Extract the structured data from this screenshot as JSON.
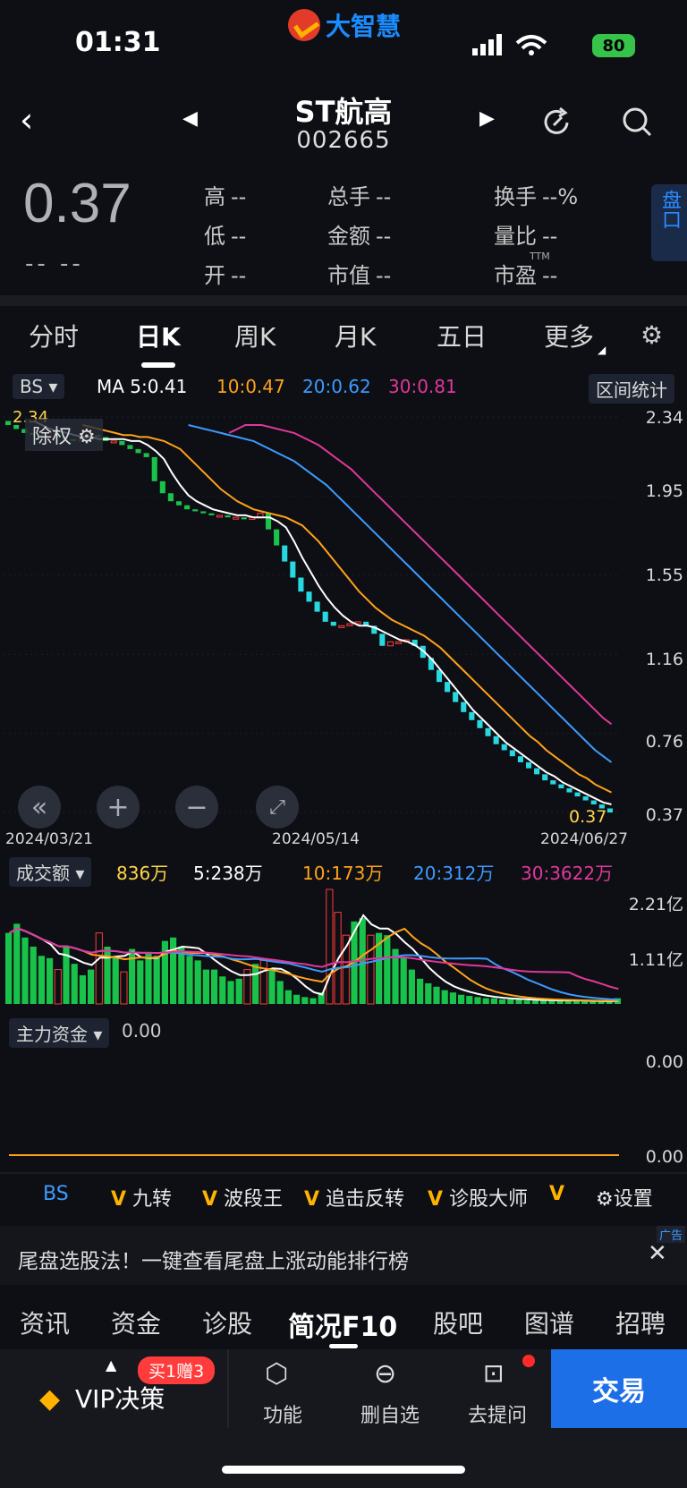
{
  "status": {
    "time": "01:31",
    "app_logo": "大智慧",
    "battery": "80"
  },
  "header": {
    "title": "ST航高",
    "code": "002665"
  },
  "quote": {
    "price": "0.37",
    "change": "--  --",
    "high_label": "高",
    "high": "--",
    "low_label": "低",
    "low": "--",
    "open_label": "开",
    "open": "--",
    "vol_label": "总手",
    "vol": "--",
    "amt_label": "金额",
    "amt": "--",
    "mcap_label": "市值",
    "mcap": "--",
    "turn_label": "换手",
    "turn": "--%",
    "ratio_label": "量比",
    "ratio": "--",
    "pe_label": "市盈",
    "pe": "--",
    "pe_sup": "TTM",
    "pankou": "盘口"
  },
  "tabs": [
    "分时",
    "日K",
    "周K",
    "月K",
    "五日",
    "更多"
  ],
  "ma_bar": {
    "bs": "BS",
    "ma5": "MA 5:0.41",
    "ma10": "10:0.47",
    "ma20": "20:0.62",
    "ma30": "30:0.81",
    "range_btn": "区间统计"
  },
  "chart_data": {
    "type": "candlestick",
    "price_axis": [
      "2.34",
      "1.95",
      "1.55",
      "1.16",
      "0.76",
      "0.37"
    ],
    "dates": [
      "2024/03/21",
      "2024/05/14",
      "2024/06/27"
    ],
    "ylim": [
      0.37,
      2.34
    ],
    "last_price_label": "0.37",
    "top_label": "2.34",
    "close": [
      2.3,
      2.28,
      2.26,
      2.25,
      2.24,
      2.26,
      2.24,
      2.23,
      2.22,
      2.24,
      2.25,
      2.24,
      2.22,
      2.22,
      2.2,
      2.18,
      2.16,
      2.14,
      2.02,
      1.96,
      1.92,
      1.9,
      1.88,
      1.87,
      1.86,
      1.85,
      1.85,
      1.84,
      1.84,
      1.83,
      1.84,
      1.86,
      1.78,
      1.7,
      1.62,
      1.54,
      1.47,
      1.42,
      1.37,
      1.32,
      1.3,
      1.3,
      1.31,
      1.32,
      1.3,
      1.26,
      1.2,
      1.22,
      1.22,
      1.23,
      1.2,
      1.14,
      1.08,
      1.02,
      0.97,
      0.92,
      0.87,
      0.83,
      0.79,
      0.75,
      0.71,
      0.68,
      0.65,
      0.62,
      0.59,
      0.56,
      0.53,
      0.51,
      0.49,
      0.47,
      0.45,
      0.43,
      0.41,
      0.39,
      0.37
    ],
    "ma5": [
      2.32,
      2.3,
      2.28,
      2.27,
      2.26,
      2.25,
      2.24,
      2.24,
      2.23,
      2.23,
      2.23,
      2.23,
      2.22,
      2.22,
      2.2,
      2.17,
      2.13,
      2.06,
      2.0,
      1.95,
      1.92,
      1.9,
      1.88,
      1.87,
      1.86,
      1.85,
      1.85,
      1.84,
      1.84,
      1.84,
      1.82,
      1.79,
      1.72,
      1.64,
      1.57,
      1.5,
      1.44,
      1.39,
      1.35,
      1.32,
      1.3,
      1.3,
      1.29,
      1.27,
      1.25,
      1.23,
      1.22,
      1.2,
      1.17,
      1.13,
      1.08,
      1.03,
      0.98,
      0.93,
      0.88,
      0.84,
      0.8,
      0.76,
      0.72,
      0.69,
      0.66,
      0.63,
      0.6,
      0.57,
      0.55,
      0.52,
      0.5,
      0.48,
      0.46,
      0.44,
      0.42,
      0.41
    ],
    "ma10": [
      2.3,
      2.29,
      2.28,
      2.27,
      2.26,
      2.25,
      2.25,
      2.24,
      2.24,
      2.23,
      2.22,
      2.2,
      2.18,
      2.14,
      2.1,
      2.06,
      2.02,
      1.98,
      1.95,
      1.92,
      1.9,
      1.88,
      1.87,
      1.86,
      1.85,
      1.84,
      1.82,
      1.8,
      1.76,
      1.72,
      1.67,
      1.62,
      1.57,
      1.52,
      1.47,
      1.43,
      1.39,
      1.36,
      1.33,
      1.31,
      1.29,
      1.27,
      1.25,
      1.22,
      1.19,
      1.15,
      1.11,
      1.07,
      1.03,
      0.99,
      0.95,
      0.91,
      0.87,
      0.83,
      0.79,
      0.75,
      0.72,
      0.68,
      0.65,
      0.62,
      0.59,
      0.56,
      0.54,
      0.51,
      0.49,
      0.47
    ],
    "ma20": [
      2.3,
      2.29,
      2.28,
      2.27,
      2.26,
      2.25,
      2.24,
      2.23,
      2.22,
      2.2,
      2.18,
      2.16,
      2.14,
      2.12,
      2.09,
      2.06,
      2.03,
      2.0,
      1.96,
      1.92,
      1.88,
      1.84,
      1.8,
      1.76,
      1.72,
      1.68,
      1.64,
      1.6,
      1.56,
      1.52,
      1.48,
      1.44,
      1.4,
      1.36,
      1.32,
      1.28,
      1.24,
      1.2,
      1.16,
      1.12,
      1.08,
      1.04,
      1.0,
      0.96,
      0.92,
      0.88,
      0.84,
      0.8,
      0.76,
      0.72,
      0.68,
      0.65,
      0.62
    ],
    "ma30": [
      2.26,
      2.28,
      2.3,
      2.3,
      2.3,
      2.29,
      2.28,
      2.27,
      2.26,
      2.24,
      2.22,
      2.2,
      2.17,
      2.14,
      2.11,
      2.08,
      2.04,
      2.0,
      1.96,
      1.92,
      1.88,
      1.84,
      1.8,
      1.76,
      1.72,
      1.68,
      1.64,
      1.6,
      1.56,
      1.52,
      1.48,
      1.44,
      1.4,
      1.36,
      1.32,
      1.28,
      1.24,
      1.2,
      1.16,
      1.12,
      1.08,
      1.04,
      1.0,
      0.96,
      0.92,
      0.88,
      0.84,
      0.81
    ]
  },
  "volume": {
    "label": "成交额",
    "cur": "836万",
    "ma5": "5:238万",
    "ma10": "10:173万",
    "ma20": "20:312万",
    "ma30": "30:3622万",
    "axis": [
      "2.21亿",
      "1.11亿"
    ],
    "bars": [
      0.62,
      0.7,
      0.58,
      0.5,
      0.42,
      0.4,
      0.3,
      0.5,
      0.35,
      0.25,
      0.3,
      0.62,
      0.5,
      0.4,
      0.28,
      0.48,
      0.38,
      0.45,
      0.42,
      0.55,
      0.58,
      0.5,
      0.42,
      0.38,
      0.3,
      0.3,
      0.24,
      0.2,
      0.22,
      0.3,
      0.35,
      0.38,
      0.3,
      0.2,
      0.12,
      0.08,
      0.06,
      0.05,
      0.1,
      1.0,
      0.8,
      0.6,
      0.72,
      0.75,
      0.6,
      0.62,
      0.6,
      0.48,
      0.4,
      0.3,
      0.22,
      0.18,
      0.15,
      0.12,
      0.1,
      0.08,
      0.07,
      0.06,
      0.05,
      0.05,
      0.04,
      0.04,
      0.04,
      0.03,
      0.03,
      0.03,
      0.03,
      0.03,
      0.03,
      0.03,
      0.02,
      0.02,
      0.02,
      0.02,
      0.05
    ],
    "up": [
      0,
      0,
      0,
      0,
      0,
      0,
      1,
      0,
      0,
      0,
      0,
      1,
      0,
      0,
      1,
      0,
      0,
      0,
      0,
      0,
      0,
      0,
      0,
      0,
      0,
      0,
      0,
      0,
      0,
      1,
      0,
      1,
      0,
      0,
      0,
      0,
      0,
      0,
      0,
      1,
      1,
      1,
      0,
      0,
      1,
      0,
      0,
      0,
      0,
      0,
      0,
      0,
      0,
      0,
      0,
      0,
      0,
      0,
      0,
      0,
      0,
      0,
      0,
      0,
      0,
      0,
      0,
      0,
      0,
      0,
      0,
      0,
      0,
      0,
      0
    ]
  },
  "fund": {
    "label": "主力资金",
    "value": "0.00",
    "axis_top": "0.00",
    "axis_bottom": "0.00"
  },
  "indicators": {
    "bs": "BS",
    "i1": "九转",
    "i2": "波段王",
    "i3": "追击反转",
    "i4": "诊股大师",
    "settings": "设置"
  },
  "ad": {
    "text": "尾盘选股法！一键查看尾盘上涨动能排行榜",
    "tag": "广告"
  },
  "f10_tabs": [
    "资讯",
    "资金",
    "诊股",
    "简况F10",
    "股吧",
    "图谱",
    "招聘"
  ],
  "bottom": {
    "vip": "VIP决策",
    "promo": "买1赠3",
    "func": "功能",
    "del": "删自选",
    "ask": "去提问",
    "trade": "交易"
  },
  "restore_label": "除权",
  "colors": {
    "up": "#ff3b3b",
    "down": "#19c24a",
    "ma5": "#ffffff",
    "ma10": "#ffa21a",
    "ma20": "#3d9bff",
    "ma30": "#e0389a",
    "accent": "#1d6fe8"
  }
}
